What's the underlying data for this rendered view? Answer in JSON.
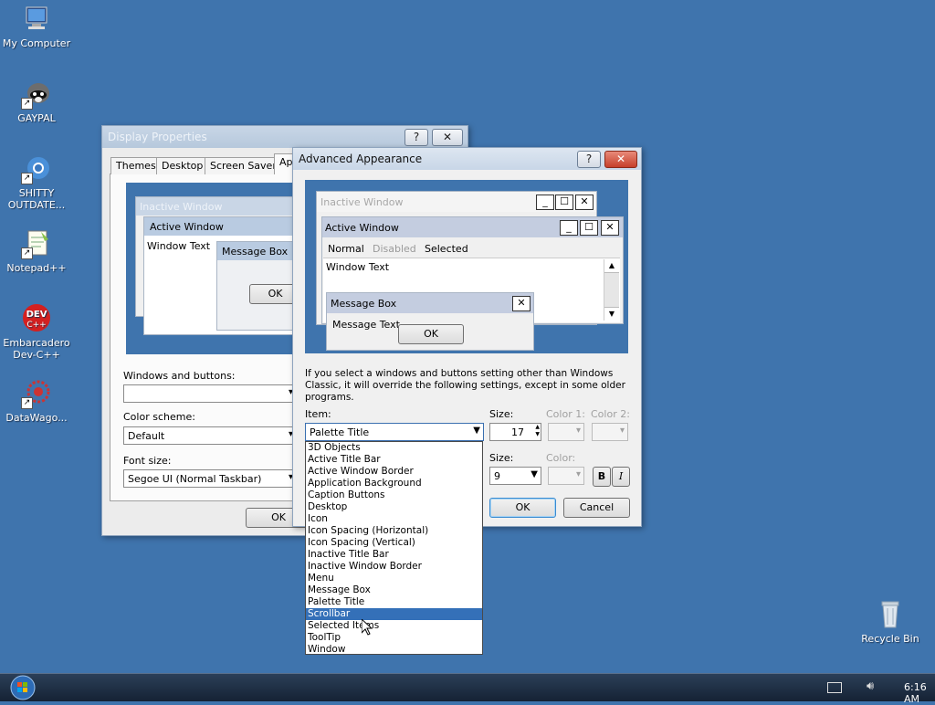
{
  "desktop": {
    "icons": [
      {
        "label": "My Computer",
        "icon": "computer-icon"
      },
      {
        "label": "GAYPAL",
        "icon": "raccoon-icon"
      },
      {
        "label": "SHITTY OUTDATE...",
        "icon": "browser-icon"
      },
      {
        "label": "Notepad++",
        "icon": "notepad-plus-icon"
      },
      {
        "label": "Embarcadero Dev-C++",
        "icon": "dev-cpp-icon"
      },
      {
        "label": "DataWago...",
        "icon": "datawagon-icon"
      },
      {
        "label": "Recycle Bin",
        "icon": "recycle-bin-icon"
      }
    ],
    "background_color": "#3f74ad"
  },
  "display_props": {
    "title": "Display Properties",
    "help": "?",
    "close": "✕",
    "tabs": [
      "Themes",
      "Desktop",
      "Screen Saver",
      "Ap"
    ],
    "preview": {
      "inactive_title": "Inactive Window",
      "active_title": "Active Window",
      "window_text": "Window Text",
      "msgbox_title": "Message Box",
      "ok": "OK"
    },
    "windows_buttons_label": "Windows and buttons:",
    "windows_buttons_value": "",
    "color_scheme_label": "Color scheme:",
    "color_scheme_value": "Default",
    "font_size_label": "Font size:",
    "font_size_value": "Segoe UI (Normal Taskbar)",
    "ok": "OK"
  },
  "advanced": {
    "title": "Advanced Appearance",
    "help": "?",
    "close": "✕",
    "preview": {
      "inactive_title": "Inactive Window",
      "active_title": "Active Window",
      "menu_normal": "Normal",
      "menu_disabled": "Disabled",
      "menu_selected": "Selected",
      "window_text": "Window Text",
      "msgbox_title": "Message Box",
      "msgbox_text": "Message Text",
      "ok": "OK",
      "min": "_",
      "max": "☐",
      "close": "✕"
    },
    "info_text": "If you select a windows and buttons setting other than Windows Classic, it will override the following settings, except in some older programs.",
    "item_label": "Item:",
    "item_value": "Palette Title",
    "size_label": "Size:",
    "size_value": "17",
    "color1_label": "Color 1:",
    "color2_label": "Color 2:",
    "font_size_label": "Size:",
    "font_size_value": "9",
    "font_color_label": "Color:",
    "bold": "B",
    "italic": "I",
    "ok": "OK",
    "cancel": "Cancel",
    "dropdown_items": [
      "3D Objects",
      "Active Title Bar",
      "Active Window Border",
      "Application Background",
      "Caption Buttons",
      "Desktop",
      "Icon",
      "Icon Spacing (Horizontal)",
      "Icon Spacing (Vertical)",
      "Inactive Title Bar",
      "Inactive Window Border",
      "Menu",
      "Message Box",
      "Palette Title",
      "Scrollbar",
      "Selected Items",
      "ToolTip",
      "Window"
    ],
    "selected_index": 14
  },
  "taskbar": {
    "start": "start-orb-icon",
    "clock": "6:16 AM"
  }
}
